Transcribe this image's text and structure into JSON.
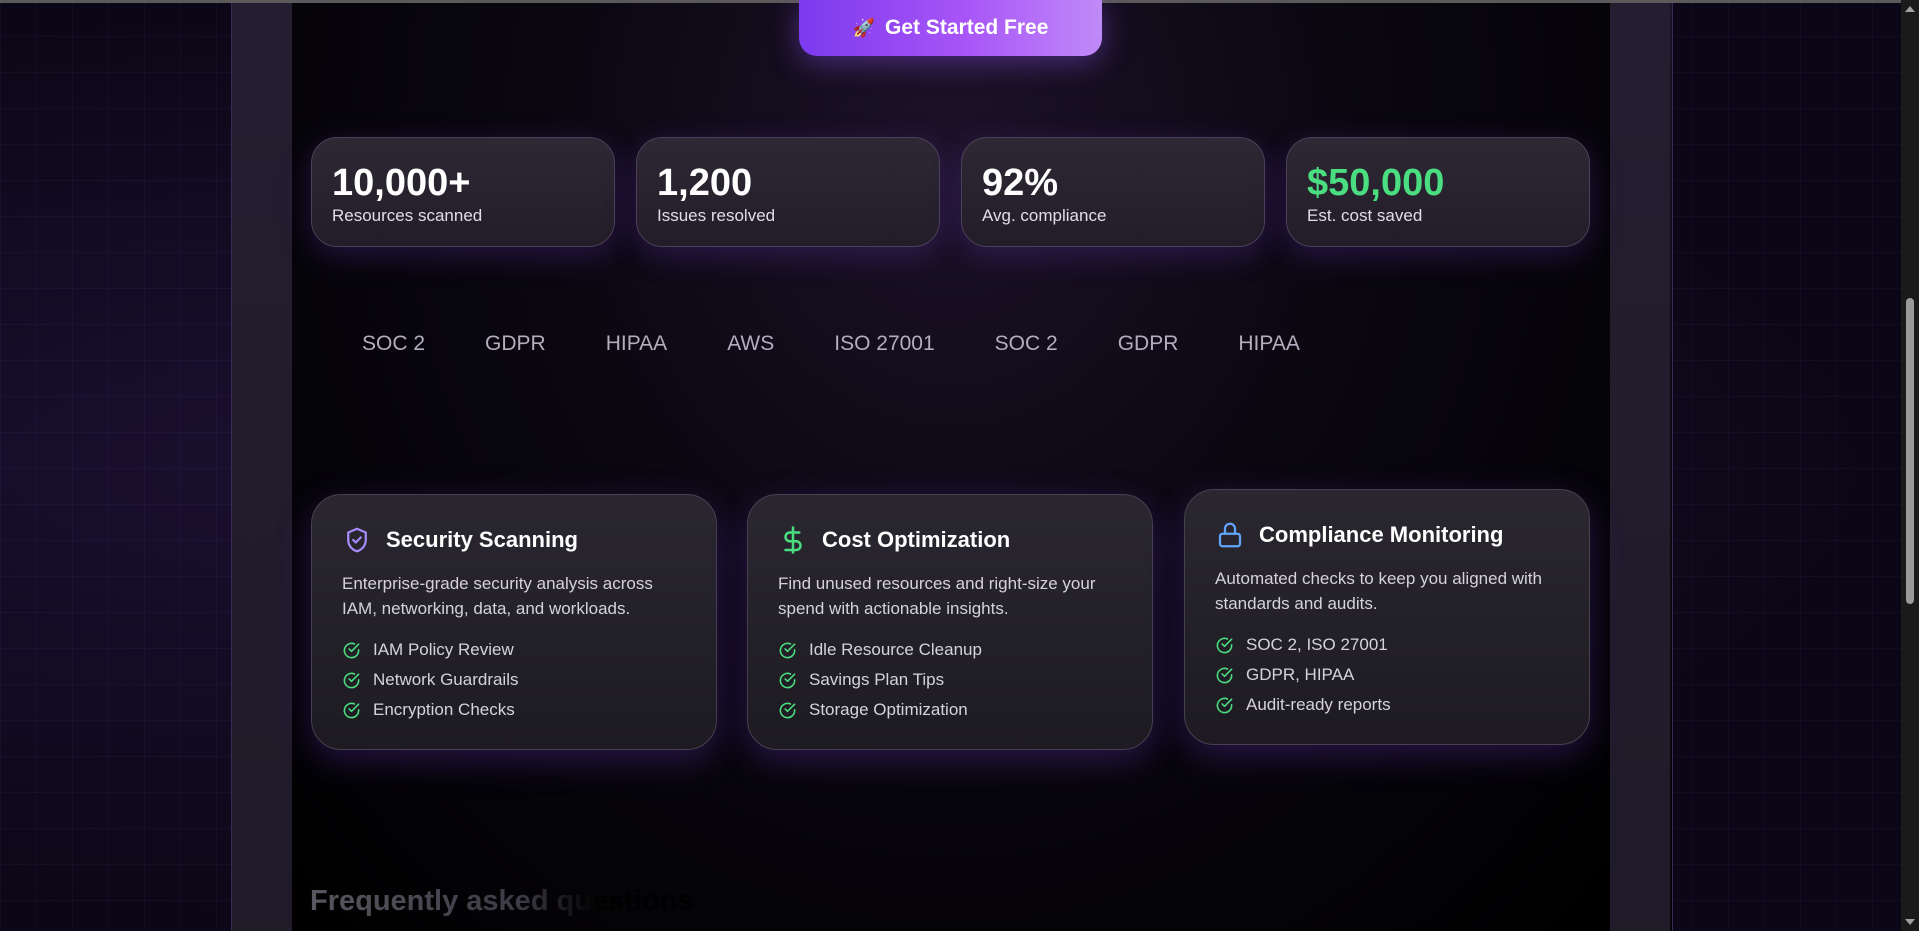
{
  "cta": {
    "icon": "rocket-icon",
    "emoji": "🚀",
    "label": "Get Started Free"
  },
  "stats": [
    {
      "value": "10,000+",
      "label": "Resources scanned",
      "color": "#ffffff"
    },
    {
      "value": "1,200",
      "label": "Issues resolved",
      "color": "#ffffff"
    },
    {
      "value": "92%",
      "label": "Avg. compliance",
      "color": "#ffffff"
    },
    {
      "value": "$50,000",
      "label": "Est. cost saved",
      "color": "#4ade80"
    }
  ],
  "badges": [
    "SOC 2",
    "GDPR",
    "HIPAA",
    "AWS",
    "ISO 27001",
    "SOC 2",
    "GDPR",
    "HIPAA"
  ],
  "features": [
    {
      "icon": "shield-check-icon",
      "title": "Security Scanning",
      "description": "Enterprise-grade security analysis across IAM, networking, data, and workloads.",
      "items": [
        "IAM Policy Review",
        "Network Guardrails",
        "Encryption Checks"
      ]
    },
    {
      "icon": "dollar-icon",
      "title": "Cost Optimization",
      "description": "Find unused resources and right-size your spend with actionable insights.",
      "items": [
        "Idle Resource Cleanup",
        "Savings Plan Tips",
        "Storage Optimization"
      ]
    },
    {
      "icon": "lock-icon",
      "title": "Compliance Monitoring",
      "description": "Automated checks to keep you aligned with standards and audits.",
      "items": [
        "SOC 2, ISO 27001",
        "GDPR, HIPAA",
        "Audit-ready reports"
      ]
    }
  ],
  "faq": {
    "title": "Frequently asked questions"
  },
  "colors": {
    "accent": "#a855f7",
    "check": "#4ade80",
    "shield": "#a78bfa",
    "lock": "#60a5fa"
  }
}
